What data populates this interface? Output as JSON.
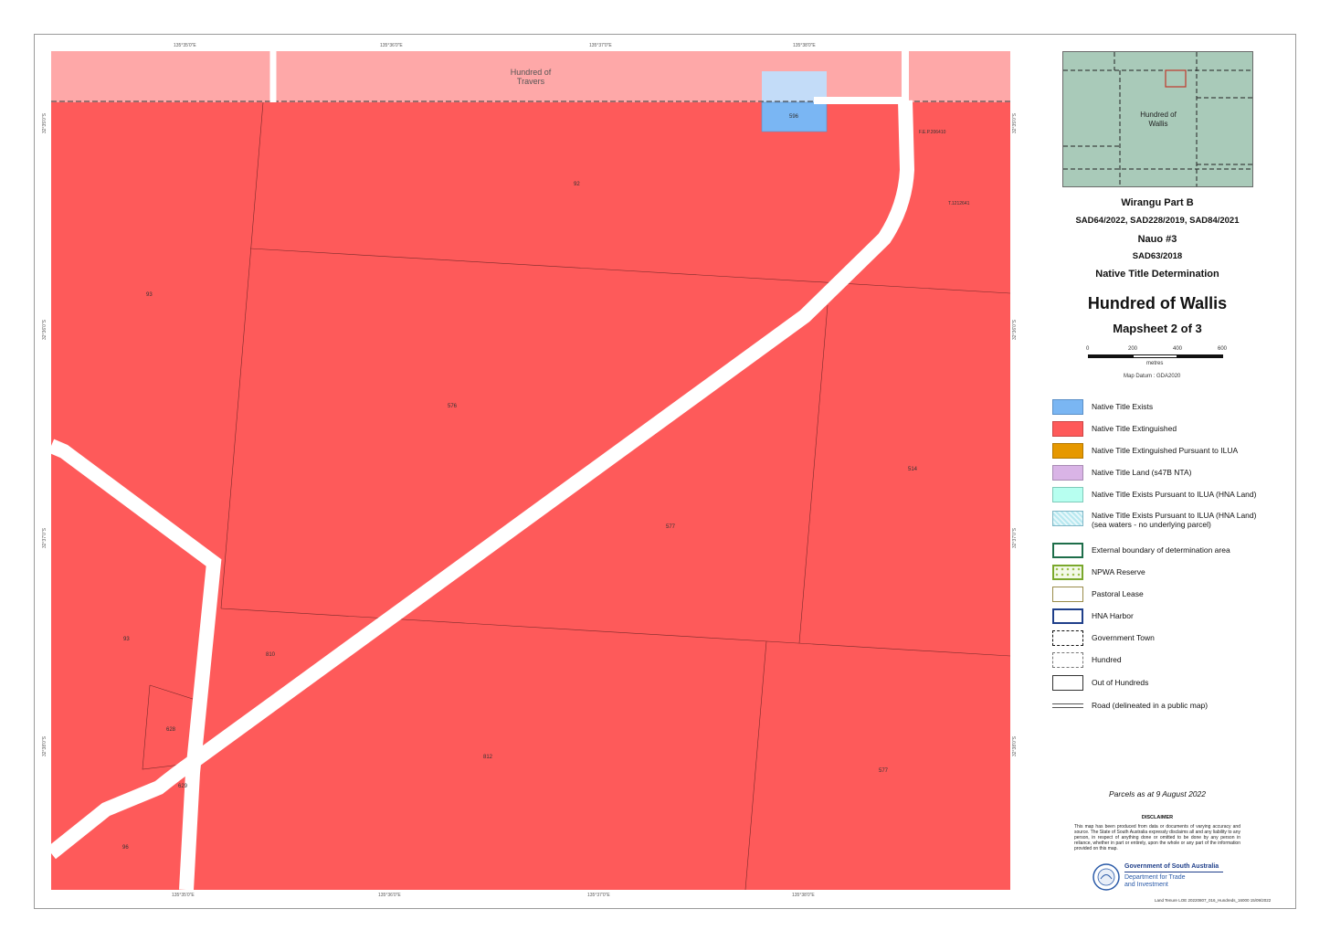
{
  "map": {
    "hundred_travers": "Hundred of\nTravers",
    "parcels": [
      "596",
      "92",
      "93",
      "576",
      "514",
      "577",
      "93",
      "810",
      "628",
      "629",
      "812",
      "577",
      "96"
    ],
    "parcel_tags": [
      "F.E.P.206410",
      "T.1212641"
    ],
    "ticks_top": [
      "135°35'0\"E",
      "135°36'0\"E",
      "135°37'0\"E",
      "135°38'0\"E"
    ],
    "ticks_bottom": [
      "135°35'0\"E",
      "135°36'0\"E",
      "135°37'0\"E",
      "135°38'0\"E"
    ],
    "ticks_left": [
      "32°35'0\"S",
      "32°36'0\"S",
      "32°37'0\"S",
      "32°38'0\"S"
    ],
    "ticks_right": [
      "32°35'0\"S",
      "32°36'0\"S",
      "32°37'0\"S",
      "32°38'0\"S"
    ]
  },
  "inset": {
    "label": "Hundred of\nWallis"
  },
  "title": {
    "line1": "Wirangu Part B",
    "line2": "SAD64/2022, SAD228/2019, SAD84/2021",
    "line3": "Nauo #3",
    "line4": "SAD63/2018",
    "line5": "Native Title Determination",
    "main": "Hundred of Wallis",
    "sheet": "Mapsheet 2 of 3"
  },
  "scale": {
    "ticks": [
      "0",
      "200",
      "400",
      "600"
    ],
    "unit": "metres",
    "datum": "Map Datum : GDA2020"
  },
  "legend": [
    {
      "label": "Native Title Exists"
    },
    {
      "label": "Native Title Extinguished"
    },
    {
      "label": "Native Title Extinguished Pursuant to ILUA"
    },
    {
      "label": "Native Title Land (s47B NTA)"
    },
    {
      "label": "Native Title Exists Pursuant to ILUA (HNA Land)"
    },
    {
      "label": "Native Title Exists Pursuant to ILUA (HNA Land)\n(sea waters - no underlying parcel)"
    },
    {
      "label": "External boundary of determination area"
    },
    {
      "label": "NPWA Reserve"
    },
    {
      "label": "Pastoral Lease"
    },
    {
      "label": "HNA Harbor"
    },
    {
      "label": "Government Town"
    },
    {
      "label": "Hundred"
    },
    {
      "label": "Out of Hundreds"
    },
    {
      "label": "Road (delineated in a public map)"
    }
  ],
  "colors": {
    "exists": "#7ab6f3",
    "extinguished": "#fe5a5a",
    "ilua_ext": "#e69800",
    "s47b": "#d9b4e6",
    "ilua_exists": "#b7fff0",
    "travers": "#fea8a8",
    "inset": "#a9cab9"
  },
  "footer": {
    "parcels": "Parcels as at 9 August 2022",
    "disclaimer_title": "DISCLAIMER",
    "disclaimer": "This map has been produced from data or documents of varying accuracy and source. The State of South Australia expressly disclaims all and any liability to any person, in respect of anything done or omitted to be done by any person in reliance, whether in part or entirely, upon the whole or any part of the information provided on this map.",
    "gov_line1": "Government of South Australia",
    "gov_line2": "Department for Trade\nand Investment",
    "ref": "Land Tenure LOE 20220807_016_Hundreds_16000 15/09/2022"
  }
}
